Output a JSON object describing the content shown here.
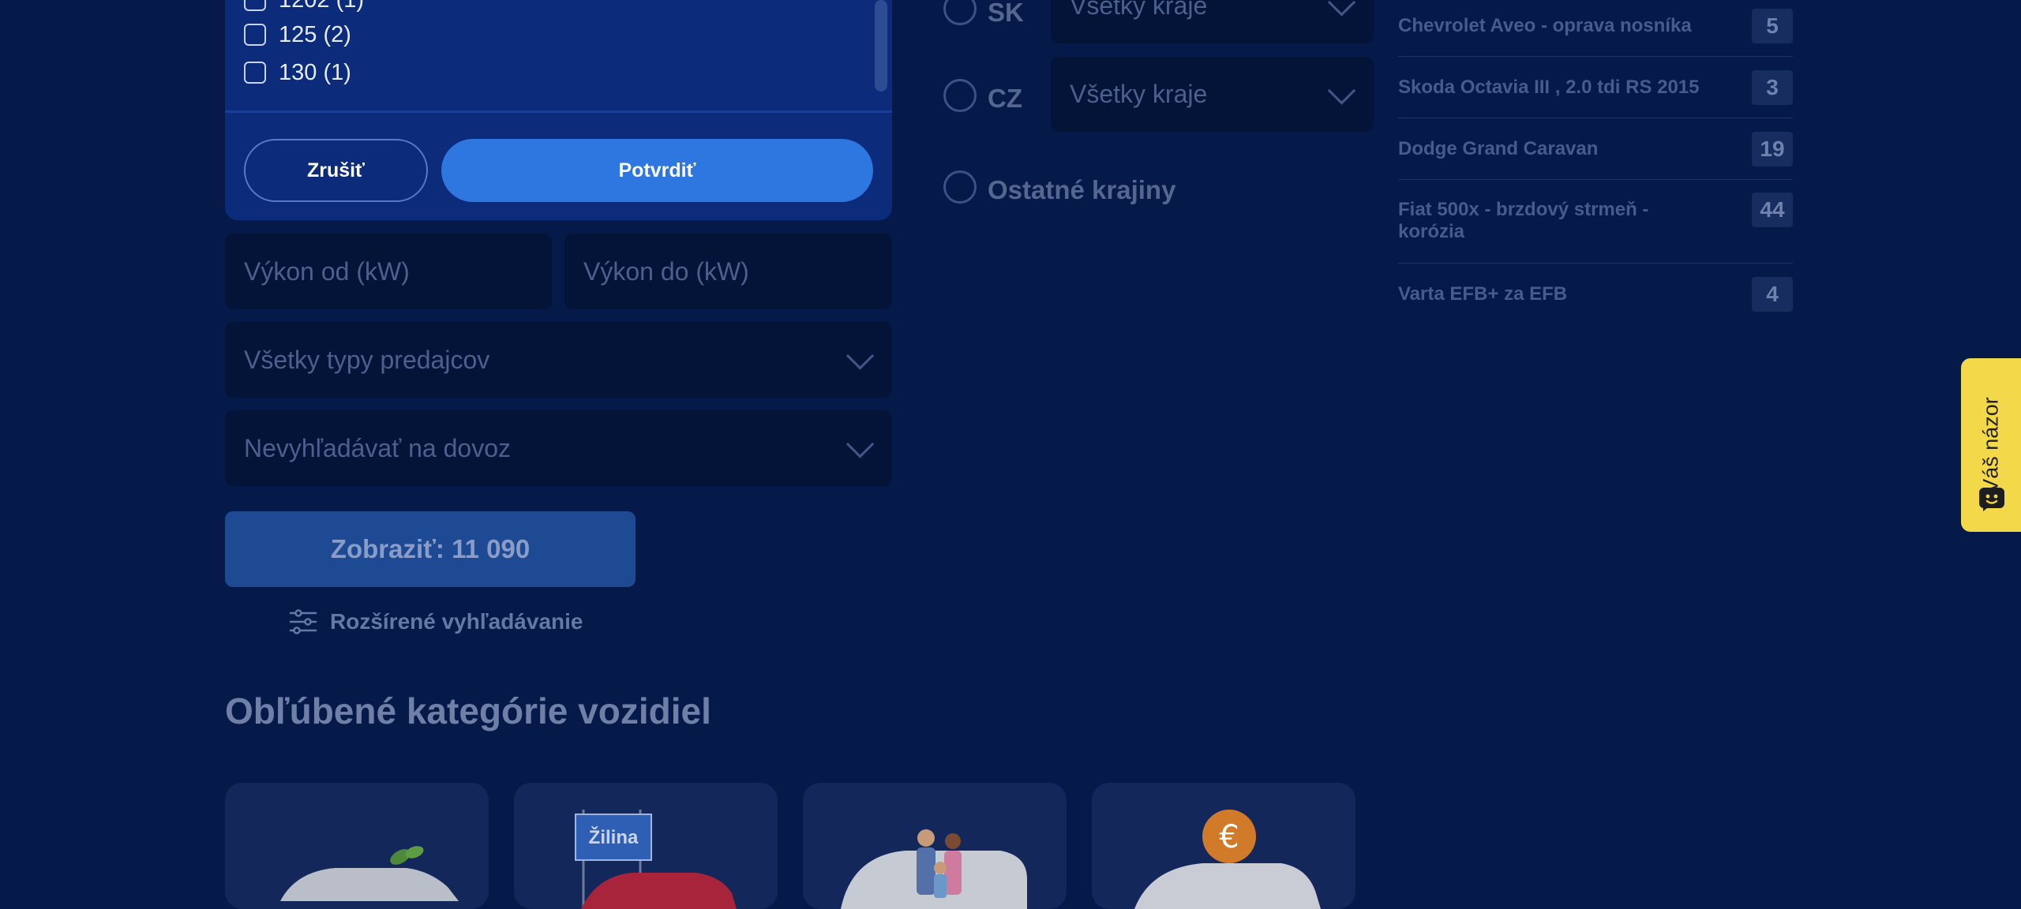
{
  "filter_panel": {
    "options": [
      {
        "label": "1202 (1)"
      },
      {
        "label": "125 (2)"
      },
      {
        "label": "130 (1)"
      }
    ],
    "cancel_label": "Zrušiť",
    "confirm_label": "Potvrdiť"
  },
  "power": {
    "from_placeholder": "Výkon od (kW)",
    "to_placeholder": "Výkon do (kW)"
  },
  "seller_type": {
    "value": "Všetky typy predajcov"
  },
  "import": {
    "value": "Nevyhľadávať na dovoz"
  },
  "show_button": {
    "label": "Zobraziť: 11 090"
  },
  "advanced_search": {
    "label": "Rozšírené vyhľadávanie",
    "icon": "sliders-icon"
  },
  "categories": {
    "title": "Obľúbené kategórie vozidiel",
    "card2_sign": "Žilina"
  },
  "regions": {
    "sk": {
      "label": "SK",
      "select": "Všetky kraje"
    },
    "cz": {
      "label": "CZ",
      "select": "Všetky kraje"
    },
    "other": {
      "label": "Ostatné krajiny"
    }
  },
  "forum_list": [
    {
      "title": "Chevrolet Aveo - oprava nosníka",
      "count": "5"
    },
    {
      "title": "Skoda Octavia III , 2.0 tdi RS 2015",
      "count": "3"
    },
    {
      "title": "Dodge Grand Caravan",
      "count": "19"
    },
    {
      "title": "Fiat 500x - brzdový strmeň - korózia",
      "count": "44"
    },
    {
      "title": "Varta EFB+ za EFB",
      "count": "4"
    }
  ],
  "feedback": {
    "label": "Váš názor"
  },
  "colors": {
    "background": "#061a4a",
    "panel": "#0c2b7a",
    "confirm_button": "#2e76e0",
    "feedback_tab": "#f3d84a"
  }
}
